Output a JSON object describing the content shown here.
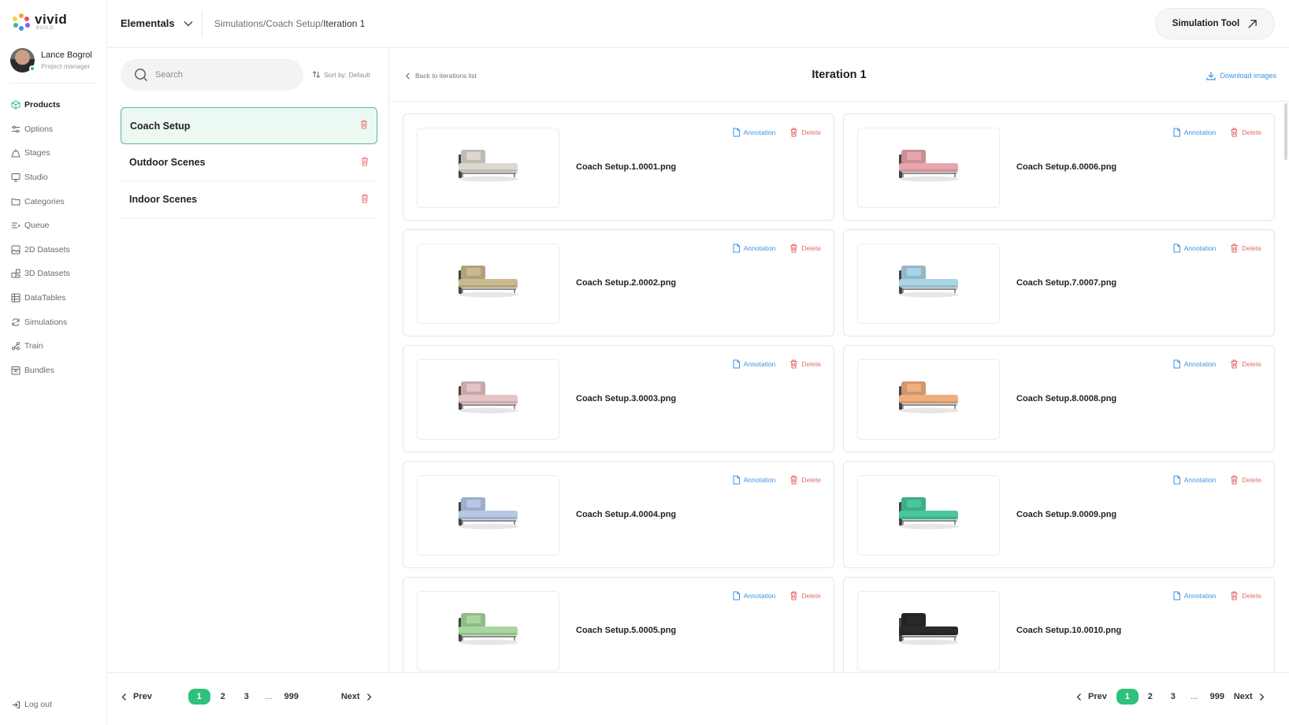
{
  "brand": {
    "name": "vivid",
    "sub": "BUILD"
  },
  "user": {
    "name": "Lance Bogrol",
    "role": "Project manager"
  },
  "nav": {
    "items": [
      {
        "label": "Products",
        "icon": "cube-icon",
        "active": true
      },
      {
        "label": "Options",
        "icon": "sliders-icon"
      },
      {
        "label": "Stages",
        "icon": "stage-icon"
      },
      {
        "label": "Studio",
        "icon": "monitor-icon"
      },
      {
        "label": "Categories",
        "icon": "folder-icon"
      },
      {
        "label": "Queue",
        "icon": "queue-icon"
      },
      {
        "label": "2D Datasets",
        "icon": "image-icon"
      },
      {
        "label": "3D Datasets",
        "icon": "boxes-icon"
      },
      {
        "label": "DataTables",
        "icon": "table-icon"
      },
      {
        "label": "Simulations",
        "icon": "refresh-icon"
      },
      {
        "label": "Train",
        "icon": "network-icon"
      },
      {
        "label": "Bundles",
        "icon": "bundle-icon"
      }
    ],
    "logout_label": "Log out"
  },
  "topbar": {
    "workspace": "Elementals",
    "breadcrumb": "Simulations/Coach Setup/",
    "breadcrumb_current": "Iteration 1",
    "simulation_tool": "Simulation Tool"
  },
  "panel": {
    "search_placeholder": "Search",
    "sort_label": "Sort by: Default",
    "scenes": [
      {
        "label": "Coach Setup",
        "active": true
      },
      {
        "label": "Outdoor Scenes"
      },
      {
        "label": "Indoor Scenes"
      }
    ]
  },
  "main": {
    "back_label": "Back to iterations list",
    "title": "Iteration 1",
    "download_label": "Download images",
    "annotation_label": "Annotation",
    "delete_label": "Delete",
    "images": [
      {
        "file": "Coach Setup.1.0001.png",
        "color": "#dcd8cf"
      },
      {
        "file": "Coach Setup.6.0006.png",
        "color": "#e7a5ae"
      },
      {
        "file": "Coach Setup.2.0002.png",
        "color": "#c9b98c"
      },
      {
        "file": "Coach Setup.7.0007.png",
        "color": "#a9d4e3"
      },
      {
        "file": "Coach Setup.3.0003.png",
        "color": "#e6c3c4"
      },
      {
        "file": "Coach Setup.8.0008.png",
        "color": "#f0ad7d"
      },
      {
        "file": "Coach Setup.4.0004.png",
        "color": "#b7c7e6"
      },
      {
        "file": "Coach Setup.9.0009.png",
        "color": "#49c69c"
      },
      {
        "file": "Coach Setup.5.0005.png",
        "color": "#a8d6a0"
      },
      {
        "file": "Coach Setup.10.0010.png",
        "color": "#2a2a2a"
      }
    ]
  },
  "pagination": {
    "prev": "Prev",
    "next": "Next",
    "pages": [
      "1",
      "2",
      "3"
    ],
    "ellipsis": "...",
    "last": "999",
    "current": "1"
  },
  "colors": {
    "accent": "#2fc07e",
    "link": "#3c91e6",
    "danger": "#e86a6a"
  }
}
